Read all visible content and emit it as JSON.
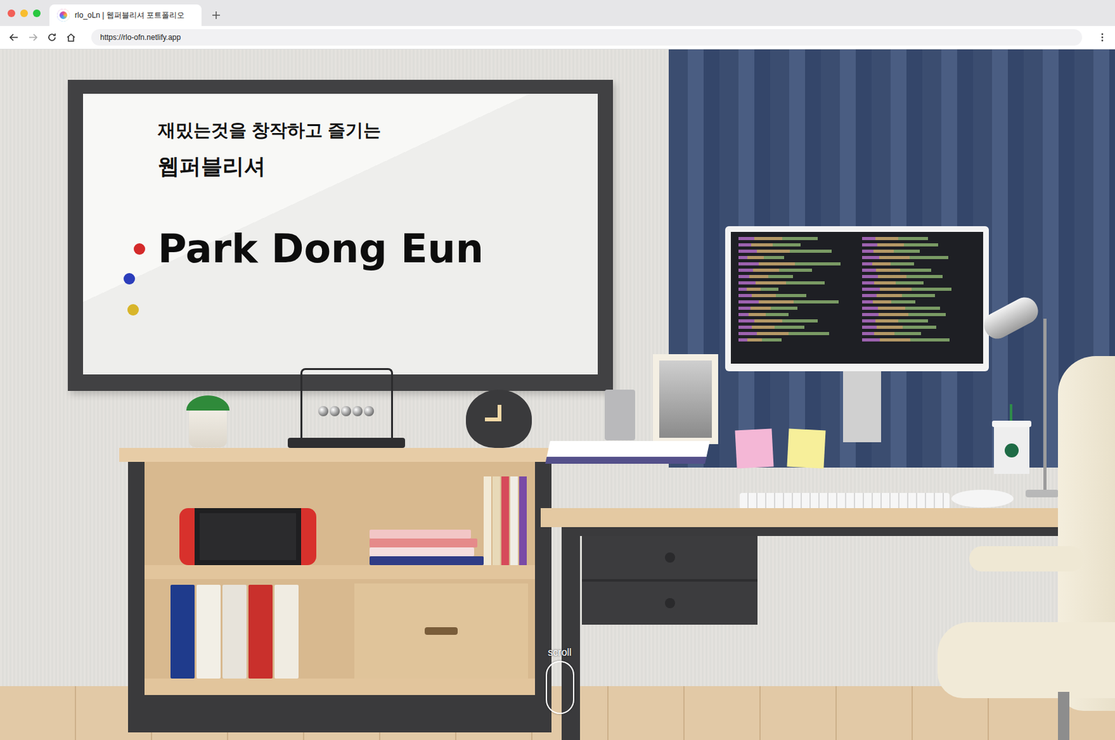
{
  "browser": {
    "tab": {
      "title": "rlo_oLn | 웹퍼블리셔 포트폴리오",
      "selected": true
    },
    "url": "https://rlo-ofn.netlify.app"
  },
  "hero": {
    "tagline": "재밌는것을 창작하고 즐기는",
    "role": "웹퍼블리셔",
    "name": "Park Dong Eun"
  },
  "scroll_hint": {
    "label": "scroll"
  }
}
